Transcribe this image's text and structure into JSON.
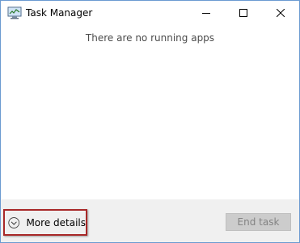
{
  "window": {
    "title": "Task Manager",
    "app_icon": "task-manager-icon",
    "buttons": {
      "minimize_icon": "minimize-icon",
      "maximize_icon": "maximize-icon",
      "close_icon": "close-icon"
    }
  },
  "main": {
    "empty_message": "There are no running apps"
  },
  "footer": {
    "more_details_label": "More details",
    "more_details_icon": "chevron-down-circle-icon",
    "end_task_label": "End task",
    "end_task_enabled": false
  },
  "colors": {
    "highlight_border": "#a82828",
    "footer_bg": "#f0f0f0",
    "window_border": "#6b9ad1"
  }
}
